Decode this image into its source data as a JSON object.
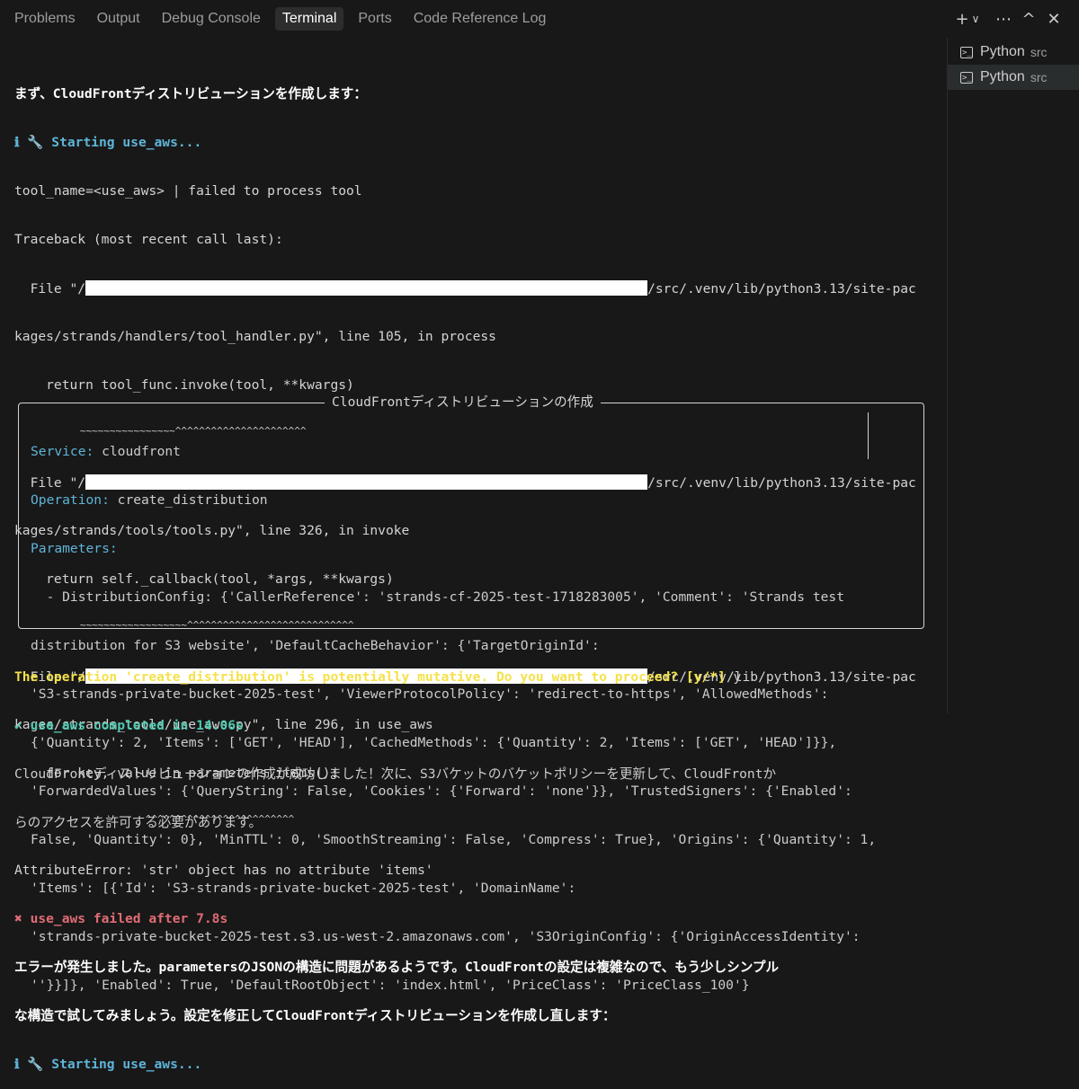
{
  "tabs": [
    "Problems",
    "Output",
    "Debug Console",
    "Terminal",
    "Ports",
    "Code Reference Log"
  ],
  "toolbar": {
    "add": "+",
    "dropdown": "∨",
    "more": "⋯",
    "maximize": "^",
    "close": "✕"
  },
  "sessions": [
    {
      "name": "Python",
      "cwd": "src"
    },
    {
      "name": "Python",
      "cwd": "src"
    }
  ],
  "terminal": {
    "l1": "まず、CloudFrontディストリビューションを作成します：",
    "l2_icon": "ℹ 🔧 ",
    "l2": "Starting use_aws...",
    "l3": "tool_name=<use_aws> | failed to process tool",
    "l4": "Traceback (most recent call last):",
    "f1_pre": "  File \"/",
    "f1_post": "/src/.venv/lib/python3.13/site-pac",
    "f1_cont": "kages/strands/handlers/tool_handler.py\", line 105, in process",
    "f1_code": "    return tool_func.invoke(tool, **kwargs)",
    "f1_wave": "           ~~~~~~~~~~~~~~~~^^^^^^^^^^^^^^^^^^^^^^",
    "f2_pre": "  File \"/",
    "f2_post": "/src/.venv/lib/python3.13/site-pac",
    "f2_cont": "kages/strands/tools/tools.py\", line 326, in invoke",
    "f2_code": "    return self._callback(tool, *args, **kwargs)",
    "f2_wave": "           ~~~~~~~~~~~~~~~~~~^^^^^^^^^^^^^^^^^^^^^^^^^^^^",
    "f3_pre": "  File \"/",
    "f3_post": "/src/.venv/lib/python3.13/site-pac",
    "f3_cont": "kages/strands_tools/use_aws.py\", line 296, in use_aws",
    "f3_code": "    for key, value in parameters.items():",
    "f3_wave": "                      ^^^^^^^^^^^^^^^^^^^^^^^^^",
    "err": "AttributeError: 'str' object has no attribute 'items'",
    "fail": "✖ use_aws failed after 7.8s",
    "msg1": "エラーが発生しました。parametersのJSONの構造に問題があるようです。CloudFrontの設定は複雑なので、もう少しシンプル",
    "msg2": "な構造で試してみましょう。設定を修正してCloudFrontディストリビューションを作成し直します：",
    "start2_icon": "ℹ 🔧 ",
    "start2": "Starting use_aws..."
  },
  "box": {
    "title": "CloudFrontディストリビューションの作成",
    "service_key": "Service:",
    "service_val": " cloudfront",
    "operation_key": "Operation:",
    "operation_val": " create_distribution",
    "params_key": "Parameters:",
    "p1": "  - DistributionConfig: {'CallerReference': 'strands-cf-2025-test-1718283005', 'Comment': 'Strands test",
    "p2": "distribution for S3 website', 'DefaultCacheBehavior': {'TargetOriginId':",
    "p3": "'S3-strands-private-bucket-2025-test', 'ViewerProtocolPolicy': 'redirect-to-https', 'AllowedMethods':",
    "p4": "{'Quantity': 2, 'Items': ['GET', 'HEAD'], 'CachedMethods': {'Quantity': 2, 'Items': ['GET', 'HEAD']}},",
    "p5": "'ForwardedValues': {'QueryString': False, 'Cookies': {'Forward': 'none'}}, 'TrustedSigners': {'Enabled':",
    "p6": "False, 'Quantity': 0}, 'MinTTL': 0, 'SmoothStreaming': False, 'Compress': True}, 'Origins': {'Quantity': 1,",
    "p7": "'Items': [{'Id': 'S3-strands-private-bucket-2025-test', 'DomainName':",
    "p8": "'strands-private-bucket-2025-test.s3.us-west-2.amazonaws.com', 'S3OriginConfig': {'OriginAccessIdentity':",
    "p9": "''}}]}, 'Enabled': True, 'DefaultRootObject': 'index.html', 'PriceClass': 'PriceClass_100'}"
  },
  "after": {
    "prompt": "The operation 'create_distribution' is potentially mutative. Do you want to proceed? [y/*]",
    "answer": " y",
    "done": "✔ use_aws completed in 14.06s",
    "m1": "CloudFrontディストリビューションの作成が成功しました！次に、S3バケットのバケットポリシーを更新して、CloudFrontか",
    "m2": "らのアクセスを許可する必要があります。"
  }
}
